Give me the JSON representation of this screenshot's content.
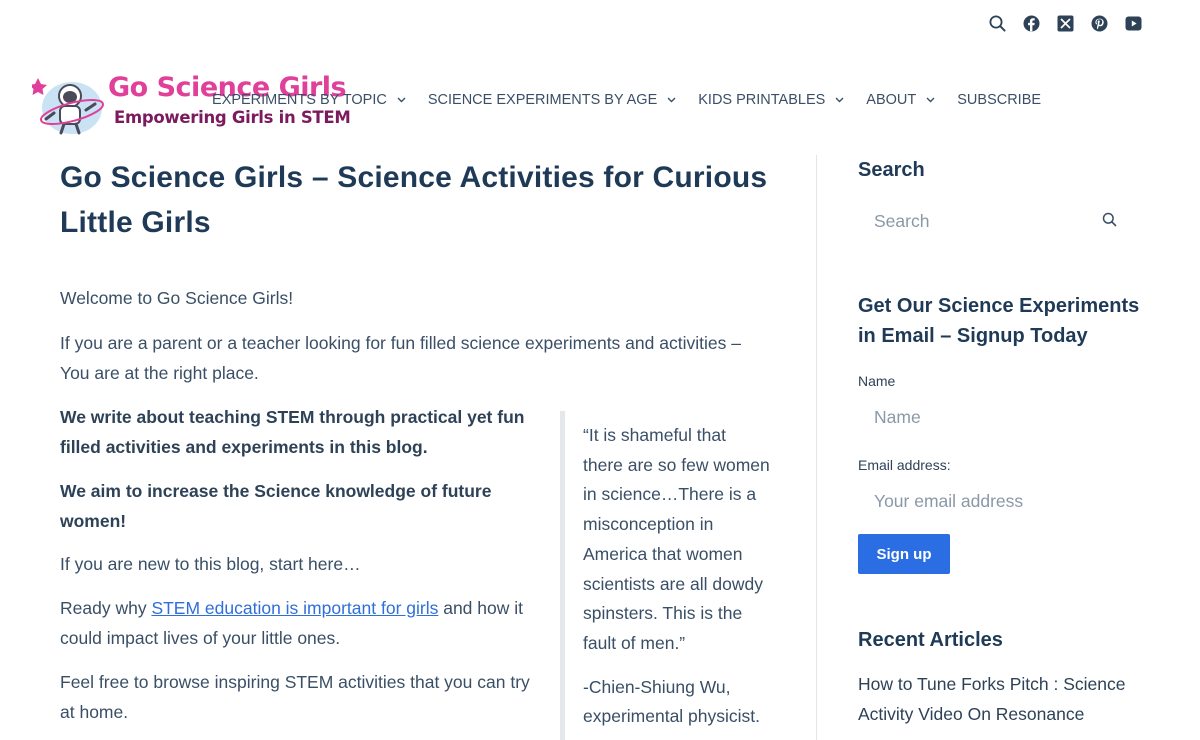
{
  "social": {
    "icons": [
      "search-icon",
      "facebook-icon",
      "x-icon",
      "pinterest-icon",
      "youtube-icon"
    ]
  },
  "header": {
    "logo_title": "Go Science Girls",
    "logo_tagline": "Empowering Girls in STEM",
    "nav": [
      {
        "label": "EXPERIMENTS BY TOPIC",
        "dropdown": true
      },
      {
        "label": "SCIENCE EXPERIMENTS BY AGE",
        "dropdown": true
      },
      {
        "label": "KIDS PRINTABLES",
        "dropdown": true
      },
      {
        "label": "ABOUT",
        "dropdown": true
      },
      {
        "label": "SUBSCRIBE",
        "dropdown": false
      }
    ]
  },
  "main": {
    "title": "Go Science Girls – Science Activities for Curious Little Girls",
    "welcome": "Welcome to Go Science Girls!",
    "intro": "If you are a parent or a teacher looking for fun filled science experiments and activities – You are at the right place.",
    "bold1": "We write about teaching STEM through practical yet fun filled activities and experiments in this blog.",
    "bold2": "We aim to increase the Science knowledge of future women!",
    "new_here": "If you are new to this blog, start here…",
    "ready_pre": "Ready why ",
    "ready_link": "STEM education is important for girls",
    "ready_post": " and how it could impact lives of your little ones.",
    "browse": "Feel free to browse inspiring STEM activities that you can try at home.",
    "quote": "“It is shameful that there are so few women in science…There is a misconception in America that women scientists are all dowdy spinsters. This is the fault of men.”",
    "quote_author": "-Chien-Shiung Wu, experimental physicist."
  },
  "sidebar": {
    "search_heading": "Search",
    "search_placeholder": "Search",
    "signup_heading": "Get Our Science Experiments in Email – Signup Today",
    "name_label": "Name",
    "name_placeholder": "Name",
    "email_label": "Email address:",
    "email_placeholder": "Your email address",
    "signup_button": "Sign up",
    "recent_heading": "Recent Articles",
    "recent": [
      "How to Tune Forks Pitch : Science Activity Video On Resonance"
    ]
  },
  "colors": {
    "heading": "#1f3a56",
    "text": "#3a4f66",
    "link": "#2f6fd9",
    "button": "#2b6de3",
    "logo_pink": "#e0409a"
  }
}
